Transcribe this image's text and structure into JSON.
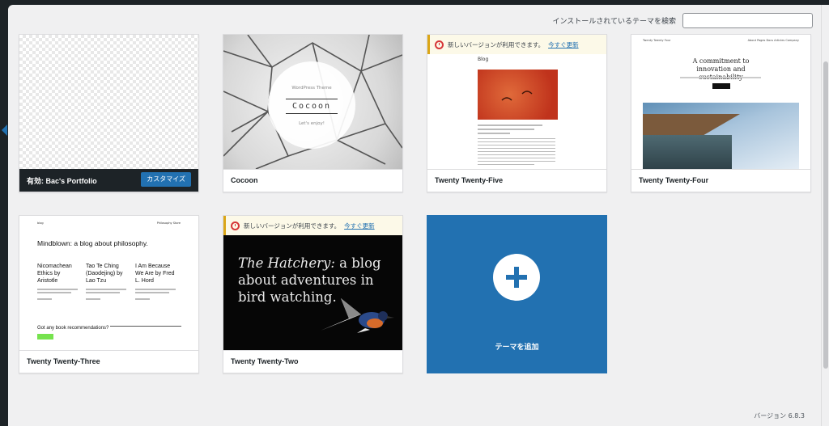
{
  "search": {
    "label": "インストールされているテーマを検索",
    "placeholder": ""
  },
  "themes": [
    {
      "name": "Bac's Portfolio",
      "active_prefix": "有効: ",
      "customize_label": "カスタマイズ"
    },
    {
      "name": "Cocoon",
      "screenshot_top": "WordPress Theme",
      "screenshot_title": "Cocoon",
      "screenshot_bottom": "Let's enjoy!"
    },
    {
      "name": "Twenty Twenty-Five",
      "screenshot_label": "Blog"
    },
    {
      "name": "Twenty Twenty-Four",
      "screenshot_brand": "Twenty Twenty Four",
      "screenshot_nav": "About   Pages   Docs   Articles   Company",
      "screenshot_heading": "A commitment to innovation and sustainability"
    },
    {
      "name": "Twenty Twenty-Three",
      "screenshot_site": "blog",
      "screenshot_nav": "Philosophy   Store",
      "screenshot_title": "Mindblown: a blog about philosophy.",
      "posts": [
        "Nicomachean Ethics by Aristotle",
        "Tao Te Ching (Daodejing) by Lao Tzu",
        "I Am Because We Are by Fred L. Hord"
      ],
      "screenshot_question": "Got any book recommendations?"
    },
    {
      "name": "Twenty Twenty-Two",
      "screenshot_italic": "The Hatchery:",
      "screenshot_rest": " a blog about adventures in bird watching."
    }
  ],
  "update_notice": {
    "text": "新しいバージョンが利用できます。",
    "link": "今すぐ更新"
  },
  "add_new": {
    "label": "テーマを追加"
  },
  "footer": {
    "version": "バージョン 6.8.3"
  },
  "colors": {
    "accent": "#2271b1",
    "admin_dark": "#1d2327",
    "notice_border": "#dba617",
    "notice_icon": "#d63638"
  }
}
